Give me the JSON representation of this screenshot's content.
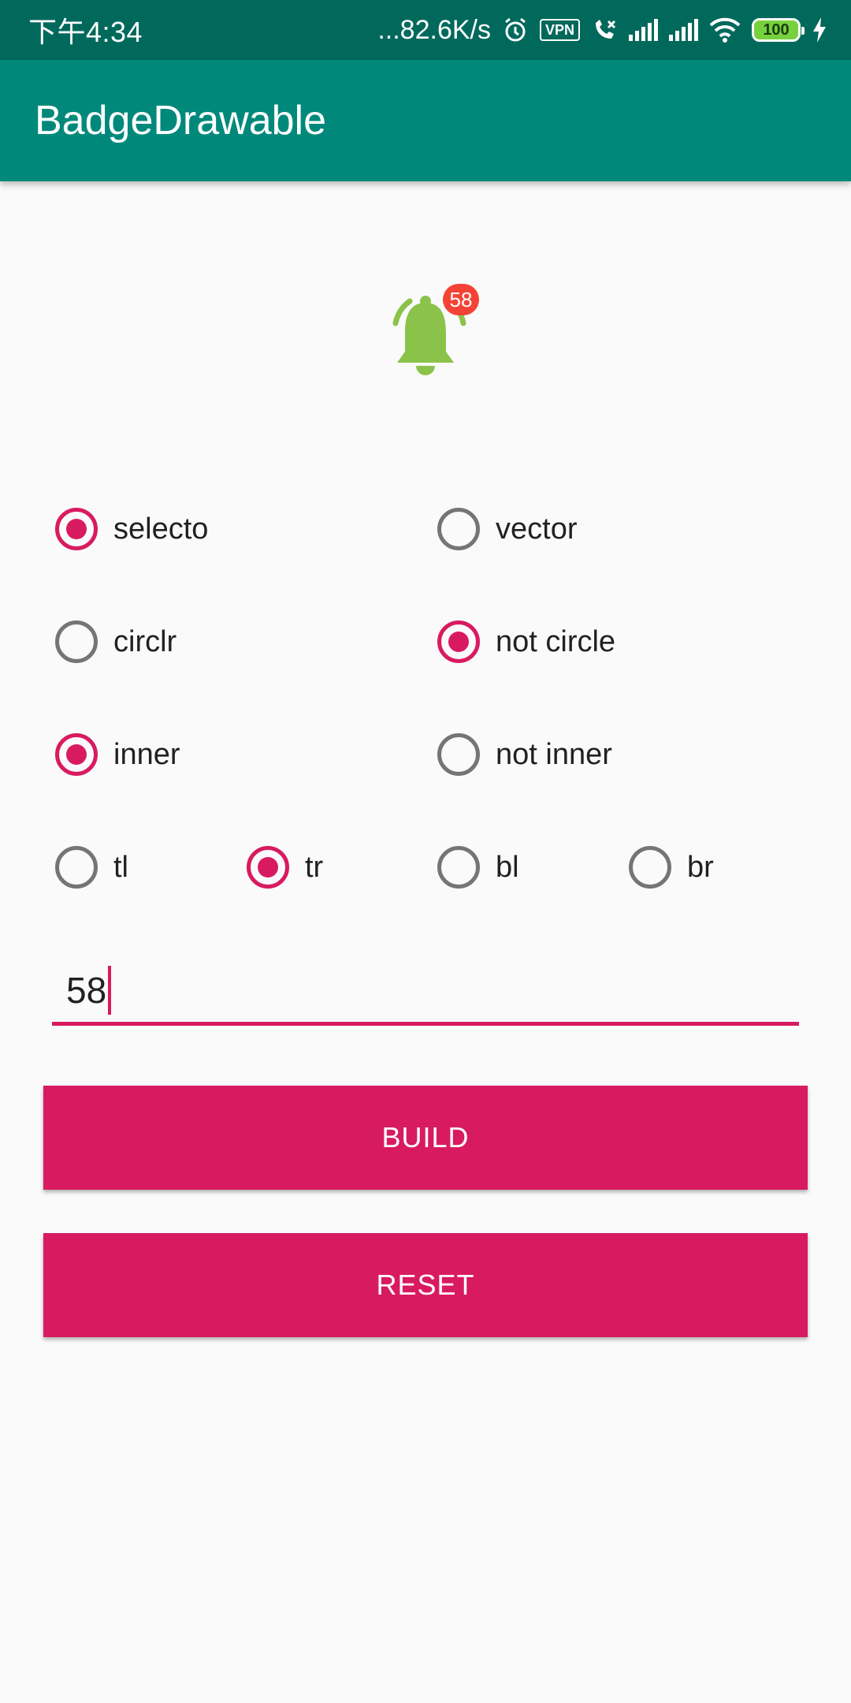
{
  "status_bar": {
    "time": "下午4:34",
    "network_speed": "...82.6K/s",
    "vpn_label": "VPN",
    "battery": "100",
    "icons": [
      "alarm-icon",
      "vpn-icon",
      "call-muted-icon",
      "signal-icon",
      "signal-icon",
      "wifi-icon",
      "battery-icon",
      "charging-icon"
    ]
  },
  "app_bar": {
    "title": "BadgeDrawable"
  },
  "preview": {
    "icon": "bell-icon",
    "badge_count": "58",
    "bell_color": "#8bc34a",
    "badge_color": "#f44336"
  },
  "options": {
    "source": [
      {
        "label": "selecto",
        "checked": true
      },
      {
        "label": "vector",
        "checked": false
      }
    ],
    "shape": [
      {
        "label": "circlr",
        "checked": false
      },
      {
        "label": "not circle",
        "checked": true
      }
    ],
    "inner": [
      {
        "label": "inner",
        "checked": true
      },
      {
        "label": "not inner",
        "checked": false
      }
    ],
    "position": [
      {
        "label": "tl",
        "checked": false
      },
      {
        "label": "tr",
        "checked": true
      },
      {
        "label": "bl",
        "checked": false
      },
      {
        "label": "br",
        "checked": false
      }
    ]
  },
  "input": {
    "value": "58"
  },
  "buttons": {
    "build": "BUILD",
    "reset": "RESET"
  },
  "colors": {
    "accent": "#d81b60",
    "primary": "#00897b",
    "primary_dark": "#00695c"
  }
}
